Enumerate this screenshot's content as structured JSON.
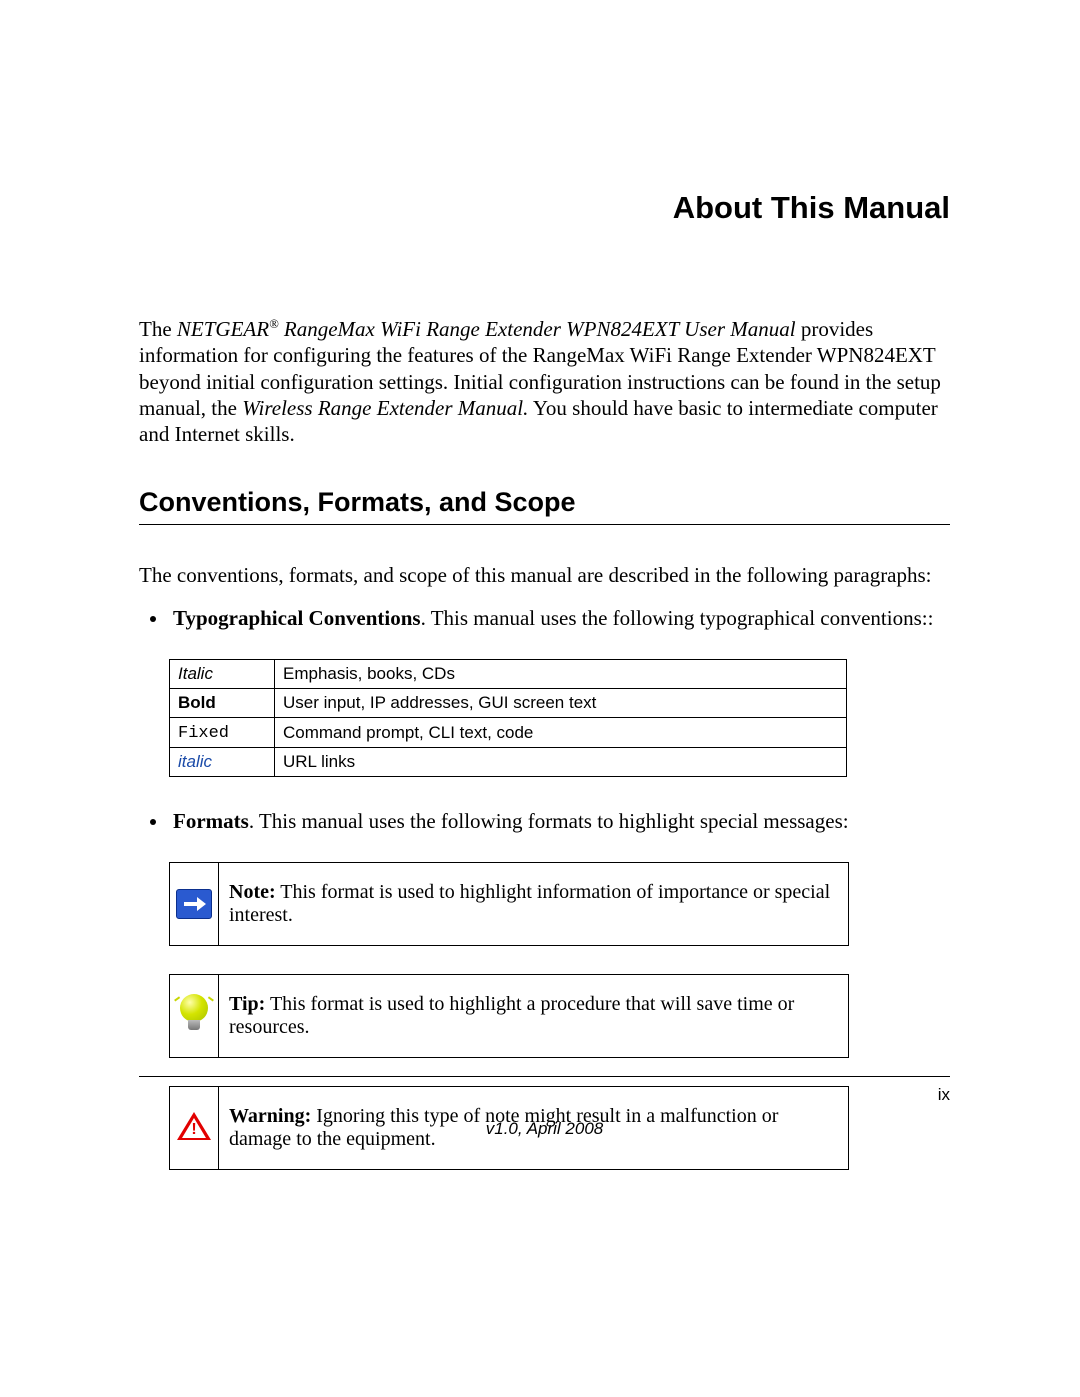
{
  "title": "About This Manual",
  "intro": {
    "pre": "The ",
    "manual_name": "NETGEAR",
    "reg": "®",
    "manual_name2": " RangeMax WiFi Range Extender WPN824EXT User Manual",
    "post1": "  provides information for configuring the features of the RangeMax WiFi Range Extender WPN824EXT beyond initial configuration settings. Initial configuration instructions can be found in the setup manual, the ",
    "other_manual": "Wireless Range Extender Manual.",
    "post2": " You should have basic to intermediate computer and Internet skills."
  },
  "section_heading": "Conventions, Formats, and Scope",
  "section_intro": "The conventions, formats, and scope of this manual are described in the following paragraphs:",
  "bullet1": {
    "label": "Typographical Conventions",
    "text": ". This manual uses the following typographical conventions::"
  },
  "conv_table": [
    {
      "c1": "Italic",
      "c1style": "italic",
      "c2": "Emphasis, books, CDs"
    },
    {
      "c1": "Bold",
      "c1style": "bold",
      "c2": "User input, IP addresses, GUI screen text"
    },
    {
      "c1": "Fixed",
      "c1style": "fixed",
      "c2": "Command prompt, CLI text, code"
    },
    {
      "c1": "italic",
      "c1style": "link",
      "c2": "URL links"
    }
  ],
  "bullet2": {
    "label": "Formats",
    "text": ". This manual uses the following formats to highlight special messages:"
  },
  "note": {
    "label": "Note:",
    "text": " This format is used to highlight information of importance or special interest."
  },
  "tip": {
    "label": "Tip:",
    "text": " This format is used to highlight a procedure that will save time or resources."
  },
  "warning": {
    "label": "Warning:",
    "text": " Ignoring this type of note might result in a malfunction or damage to the equipment."
  },
  "page_number": "ix",
  "version": "v1.0, April 2008"
}
